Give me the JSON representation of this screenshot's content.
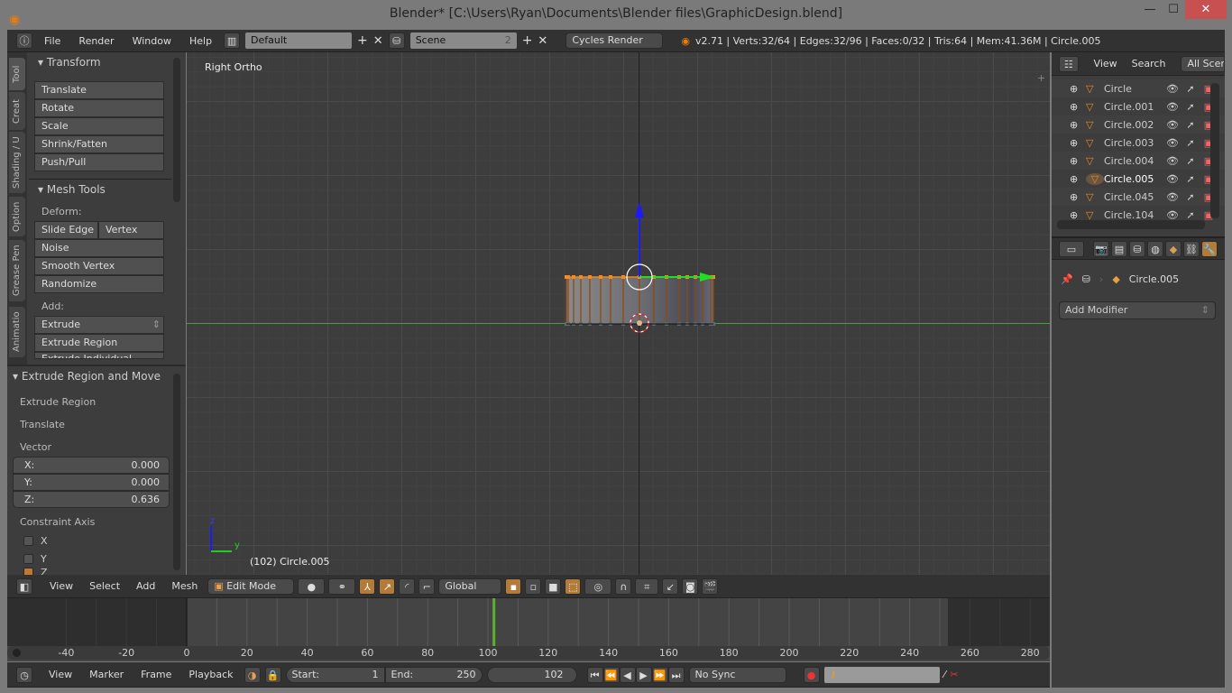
{
  "window": {
    "title": "Blender* [C:\\Users\\Ryan\\Documents\\Blender files\\GraphicDesign.blend]",
    "minimize": "—",
    "maximize": "☐",
    "close": "✕"
  },
  "info_header": {
    "menus": [
      "File",
      "Render",
      "Window",
      "Help"
    ],
    "layout": "Default",
    "scene": "Scene",
    "scene_users": "2",
    "engine": "Cycles Render",
    "stats": "v2.71 | Verts:32/64 | Edges:32/96 | Faces:0/32 | Tris:64 | Mem:41.36M | Circle.005"
  },
  "tool_tabs": [
    "Tool",
    "Creat",
    "Shading / U",
    "Option",
    "Grease Pen",
    "Animatio"
  ],
  "transform": {
    "title": "Transform",
    "buttons": [
      "Translate",
      "Rotate",
      "Scale",
      "Shrink/Fatten",
      "Push/Pull"
    ]
  },
  "mesh_tools": {
    "title": "Mesh Tools",
    "deform_label": "Deform:",
    "slide_edge": "Slide Edge",
    "vertex": "Vertex",
    "deform_buttons": [
      "Noise",
      "Smooth Vertex",
      "Randomize"
    ],
    "add_label": "Add:",
    "extrude": "Extrude",
    "extrude_region": "Extrude Region",
    "extrude_individual": "Extrude Individual"
  },
  "operator": {
    "title": "Extrude Region and Move",
    "extrude_region": "Extrude Region",
    "translate": "Translate",
    "vector_label": "Vector",
    "vector": [
      {
        "axis": "X:",
        "value": "0.000"
      },
      {
        "axis": "Y:",
        "value": "0.000"
      },
      {
        "axis": "Z:",
        "value": "0.636"
      }
    ],
    "constraint_label": "Constraint Axis",
    "constraints": [
      {
        "axis": "X",
        "checked": false
      },
      {
        "axis": "Y",
        "checked": false
      },
      {
        "axis": "Z",
        "checked": true
      }
    ]
  },
  "viewport": {
    "view_name": "Right Ortho",
    "object_info": "(102) Circle.005",
    "axis_z": "z",
    "axis_y": "y"
  },
  "view3d_header": {
    "menus": [
      "View",
      "Select",
      "Add",
      "Mesh"
    ],
    "mode": "Edit Mode",
    "orientation": "Global"
  },
  "timeline": {
    "ticks": [
      -40,
      -20,
      0,
      20,
      40,
      60,
      80,
      100,
      120,
      140,
      160,
      180,
      200,
      220,
      240,
      260,
      280
    ],
    "start": 1,
    "end": 250,
    "current": 102,
    "accent": "#5fb02f"
  },
  "timeline_header": {
    "menus": [
      "View",
      "Marker",
      "Frame",
      "Playback"
    ],
    "start_label": "Start:",
    "start": "1",
    "end_label": "End:",
    "end": "250",
    "current": "102",
    "sync": "No Sync"
  },
  "outliner": {
    "menus": [
      "View",
      "Search"
    ],
    "filter": "All Scenes",
    "items": [
      {
        "name": "Circle",
        "active": false
      },
      {
        "name": "Circle.001",
        "active": false
      },
      {
        "name": "Circle.002",
        "active": false
      },
      {
        "name": "Circle.003",
        "active": false
      },
      {
        "name": "Circle.004",
        "active": false
      },
      {
        "name": "Circle.005",
        "active": true
      },
      {
        "name": "Circle.045",
        "active": false
      },
      {
        "name": "Circle.104",
        "active": false
      }
    ]
  },
  "properties": {
    "object": "Circle.005",
    "add_modifier": "Add Modifier"
  }
}
